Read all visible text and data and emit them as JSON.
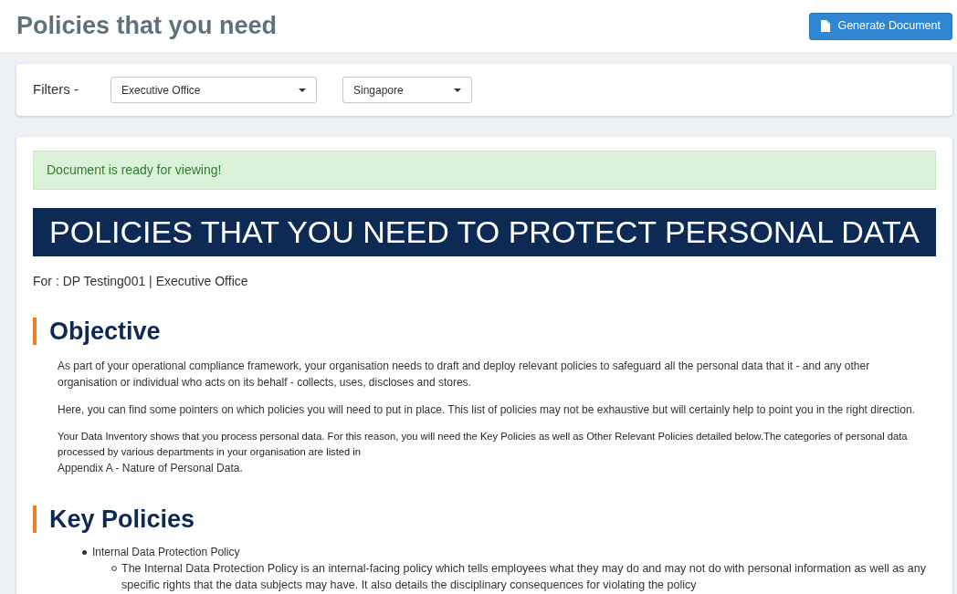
{
  "header": {
    "title": "Policies that you need",
    "generate_button": "Generate Document"
  },
  "filters": {
    "label": "Filters -",
    "selects": [
      {
        "value": "Executive Office"
      },
      {
        "value": "Singapore"
      }
    ]
  },
  "document": {
    "alert": "Document is ready for viewing!",
    "banner": "POLICIES THAT YOU NEED TO PROTECT PERSONAL DATA",
    "for_line": "For : DP Testing001 | Executive Office",
    "sections": [
      {
        "heading": "Objective",
        "paragraphs": [
          {
            "kind": "body",
            "text": "As part of your operational compliance framework, your organisation needs to draft and deploy relevant policies to safeguard all the personal data that it - and any other organisation or individual who acts on its behalf - collects, uses, discloses and stores."
          },
          {
            "kind": "body",
            "text": "Here, you can find some pointers on which policies you will need to put in place. This list of policies may not be exhaustive but will certainly help to point you in the right direction."
          },
          {
            "kind": "small",
            "text": "Your Data Inventory shows that you process personal data. For this reason, you will need the Key Policies as well as Other Relevant Policies detailed below.The categories of personal data processed by various departments in your organisation are listed in"
          },
          {
            "kind": "body",
            "text": "Appendix A - Nature of Personal Data."
          }
        ]
      },
      {
        "heading": "Key Policies",
        "items": [
          {
            "text": "Internal Data Protection Policy",
            "children": [
              {
                "text": "The Internal Data Protection Policy is an internal-facing policy which tells employees what they may do and may not do with personal information as well as any specific rights that the data subjects may have. It also details the disciplinary consequences for violating the policy"
              }
            ]
          }
        ]
      }
    ]
  }
}
